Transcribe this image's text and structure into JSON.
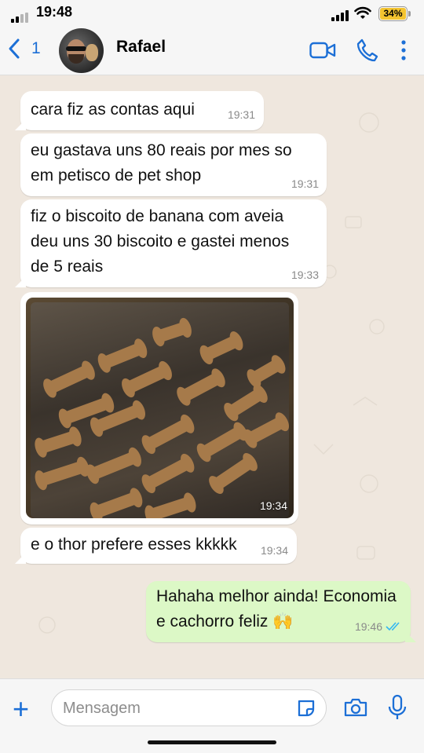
{
  "status_bar": {
    "time": "19:48",
    "battery": "34%"
  },
  "header": {
    "back_count": "1",
    "contact_name": "Rafael"
  },
  "messages": [
    {
      "text": "cara fiz as contas aqui",
      "time": "19:31"
    },
    {
      "text": "eu gastava uns 80 reais por mes so\nem petisco de pet shop",
      "time": "19:31"
    },
    {
      "text": "fiz o biscoito de banana com aveia\ndeu uns 30 biscoito e gastei menos\nde 5 reais",
      "time": "19:33"
    },
    {
      "time": "19:34"
    },
    {
      "text": "e o thor prefere esses kkkkk",
      "time": "19:34"
    },
    {
      "text": "Hahaha melhor ainda! Economia\ne cachorro feliz 🙌",
      "time": "19:46"
    }
  ],
  "composer": {
    "placeholder": "Mensagem"
  },
  "colors": {
    "accent": "#1c6fd6",
    "incoming": "#ffffff",
    "outgoing": "#dcf8c6",
    "background": "#efe7de"
  }
}
